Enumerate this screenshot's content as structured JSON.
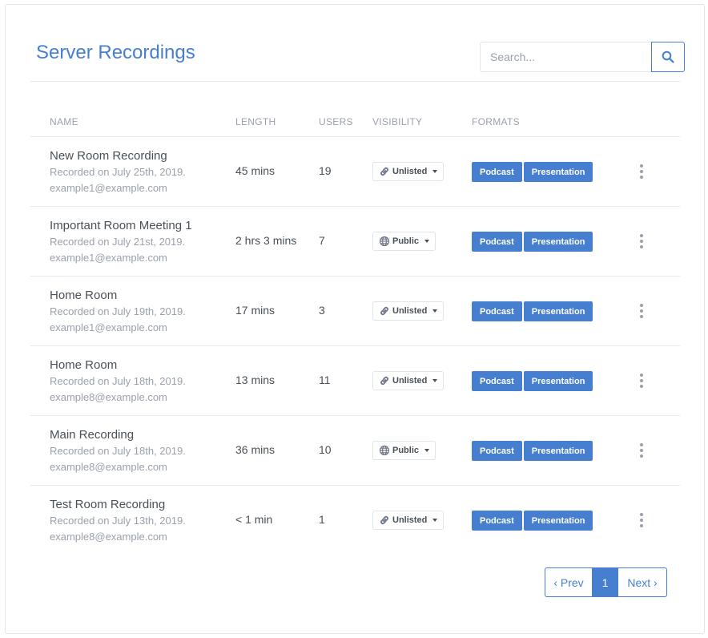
{
  "header": {
    "title": "Server Recordings"
  },
  "search": {
    "placeholder": "Search...",
    "value": ""
  },
  "table": {
    "headers": {
      "name": "NAME",
      "length": "LENGTH",
      "users": "USERS",
      "visibility": "VISIBILITY",
      "formats": "FORMATS"
    },
    "rows": [
      {
        "name": "New Room Recording",
        "recorded": "Recorded on July 25th, 2019.",
        "email": "example1@example.com",
        "length": "45 mins",
        "users": "19",
        "visibility": "Unlisted",
        "visibility_icon": "link-icon",
        "formats": [
          "Podcast",
          "Presentation"
        ]
      },
      {
        "name": "Important Room Meeting 1",
        "recorded": "Recorded on July 21st, 2019.",
        "email": "example1@example.com",
        "length": "2 hrs 3 mins",
        "users": "7",
        "visibility": "Public",
        "visibility_icon": "globe-icon",
        "formats": [
          "Podcast",
          "Presentation"
        ]
      },
      {
        "name": "Home Room",
        "recorded": "Recorded on July 19th, 2019.",
        "email": "example1@example.com",
        "length": "17 mins",
        "users": "3",
        "visibility": "Unlisted",
        "visibility_icon": "link-icon",
        "formats": [
          "Podcast",
          "Presentation"
        ]
      },
      {
        "name": "Home Room",
        "recorded": "Recorded on July 18th, 2019.",
        "email": "example8@example.com",
        "length": "13 mins",
        "users": "11",
        "visibility": "Unlisted",
        "visibility_icon": "link-icon",
        "formats": [
          "Podcast",
          "Presentation"
        ]
      },
      {
        "name": "Main Recording",
        "recorded": "Recorded on July 18th, 2019.",
        "email": "example8@example.com",
        "length": "36 mins",
        "users": "10",
        "visibility": "Public",
        "visibility_icon": "globe-icon",
        "formats": [
          "Podcast",
          "Presentation"
        ]
      },
      {
        "name": "Test Room Recording",
        "recorded": "Recorded on July 13th, 2019.",
        "email": "example8@example.com",
        "length": "< 1 min",
        "users": "1",
        "visibility": "Unlisted",
        "visibility_icon": "link-icon",
        "formats": [
          "Podcast",
          "Presentation"
        ]
      }
    ]
  },
  "pagination": {
    "prev": "‹ Prev",
    "current": "1",
    "next": "Next ›"
  },
  "colors": {
    "accent": "#467fcf",
    "muted": "#9aa0ac",
    "text": "#495057"
  }
}
